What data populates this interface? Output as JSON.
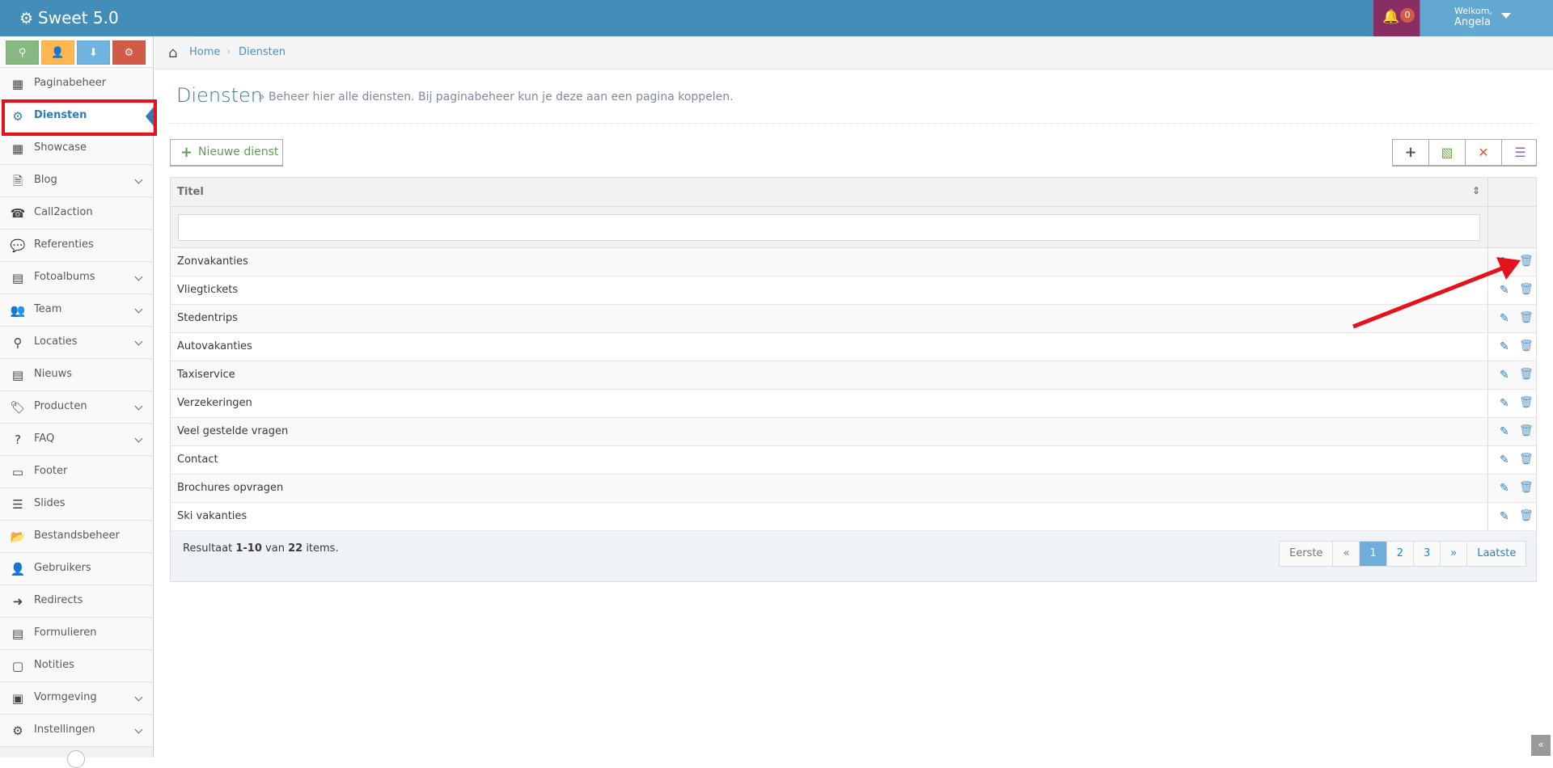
{
  "app": {
    "brand": "Sweet 5.0"
  },
  "header": {
    "notifications_count": "0",
    "welcome": "Welkom,",
    "user_name": "Angela"
  },
  "colors": {
    "navbar": "#438eb9",
    "notif_bg": "#892e65",
    "user_bg": "#62a8d1",
    "accent": "#2b7dbc",
    "annotation_red": "#e3121b"
  },
  "shortcuts": [
    {
      "icon": "map-marker-icon",
      "color": "#87b87f"
    },
    {
      "icon": "user-icon",
      "color": "#ffb752"
    },
    {
      "icon": "download-icon",
      "color": "#6fb3e0"
    },
    {
      "icon": "cogs-icon",
      "color": "#d15b47"
    }
  ],
  "sidebar": {
    "items": [
      {
        "label": "Paginabeheer",
        "icon": "table-icon",
        "submenu": false,
        "glyph": "▦"
      },
      {
        "label": "Diensten",
        "icon": "cubes-icon",
        "submenu": false,
        "active": true,
        "glyph": "⚙"
      },
      {
        "label": "Showcase",
        "icon": "grid-icon",
        "submenu": false,
        "glyph": "▦"
      },
      {
        "label": "Blog",
        "icon": "file-icon",
        "submenu": true,
        "glyph": "🗎"
      },
      {
        "label": "Call2action",
        "icon": "phone-icon",
        "submenu": false,
        "glyph": "☎"
      },
      {
        "label": "Referenties",
        "icon": "comments-icon",
        "submenu": false,
        "glyph": "💬"
      },
      {
        "label": "Fotoalbums",
        "icon": "album-icon",
        "submenu": true,
        "glyph": "▤"
      },
      {
        "label": "Team",
        "icon": "users-icon",
        "submenu": true,
        "glyph": "👥"
      },
      {
        "label": "Locaties",
        "icon": "map-marker-icon",
        "submenu": true,
        "glyph": "⚲"
      },
      {
        "label": "Nieuws",
        "icon": "newspaper-icon",
        "submenu": false,
        "glyph": "▤"
      },
      {
        "label": "Producten",
        "icon": "tags-icon",
        "submenu": true,
        "glyph": "🏷"
      },
      {
        "label": "FAQ",
        "icon": "question-icon",
        "submenu": true,
        "glyph": "?"
      },
      {
        "label": "Footer",
        "icon": "footer-icon",
        "submenu": false,
        "glyph": "▭"
      },
      {
        "label": "Slides",
        "icon": "sliders-icon",
        "submenu": false,
        "glyph": "☰"
      },
      {
        "label": "Bestandsbeheer",
        "icon": "folder-open-icon",
        "submenu": false,
        "glyph": "📂"
      },
      {
        "label": "Gebruikers",
        "icon": "user-icon",
        "submenu": false,
        "glyph": "👤"
      },
      {
        "label": "Redirects",
        "icon": "redirect-icon",
        "submenu": false,
        "glyph": "➜"
      },
      {
        "label": "Formulieren",
        "icon": "form-icon",
        "submenu": false,
        "glyph": "▤"
      },
      {
        "label": "Notities",
        "icon": "note-icon",
        "submenu": false,
        "glyph": "▢"
      },
      {
        "label": "Vormgeving",
        "icon": "layout-icon",
        "submenu": true,
        "glyph": "▣"
      },
      {
        "label": "Instellingen",
        "icon": "gear-icon",
        "submenu": true,
        "glyph": "⚙"
      }
    ]
  },
  "breadcrumb": {
    "home": "Home",
    "current": "Diensten"
  },
  "page": {
    "title": "Diensten",
    "subtitle": "» Beheer hier alle diensten. Bij paginabeheer kun je deze aan een pagina koppelen."
  },
  "toolbar": {
    "new_label": "Nieuwe dienst"
  },
  "table": {
    "column_title": "Titel",
    "filter_placeholder": "",
    "rows": [
      "Zonvakanties",
      "Vliegtickets",
      "Stedentrips",
      "Autovakanties",
      "Taxiservice",
      "Verzekeringen",
      "Veel gestelde vragen",
      "Contact",
      "Brochures opvragen",
      "Ski vakanties"
    ]
  },
  "footer": {
    "result_prefix": "Resultaat",
    "result_range": "1-10",
    "result_mid": "van",
    "result_total": "22",
    "result_suffix": "items."
  },
  "pager": {
    "first": "Eerste",
    "prev": "«",
    "pages": [
      "1",
      "2",
      "3"
    ],
    "active_page": "1",
    "next": "»",
    "last": "Laatste"
  }
}
